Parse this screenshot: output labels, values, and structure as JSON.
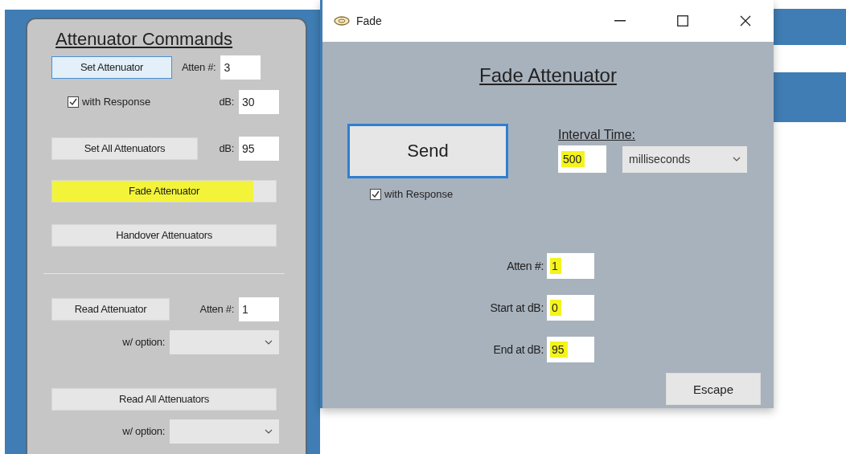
{
  "panel": {
    "title": "Attenuator Commands",
    "set_attenuator": {
      "button": "Set Attenuator",
      "focused": true,
      "atten_label": "Atten #:",
      "atten_value": "3",
      "with_response": {
        "label": "with Response",
        "checked": true
      },
      "db_label": "dB:",
      "db_value": "30"
    },
    "set_all": {
      "button": "Set All Attenuators",
      "db_label": "dB:",
      "db_value": "95"
    },
    "fade_button": {
      "label": "Fade Attenuator",
      "highlighted": true
    },
    "handover_button": {
      "label": "Handover Attenuators",
      "highlighted": false
    },
    "read_attenuator": {
      "button": "Read Attenuator",
      "atten_label": "Atten #:",
      "atten_value": "1",
      "option_label": "w/ option:"
    },
    "read_all": {
      "button": "Read All Attenuators",
      "option_label": "w/ option:"
    }
  },
  "dialog": {
    "title": "Fade",
    "heading": "Fade Attenuator",
    "send_button": "Send",
    "with_response": {
      "label": "with Response",
      "checked": true
    },
    "interval_label": "Interval Time:",
    "interval_value": {
      "value": "500",
      "highlighted": true
    },
    "unit": "milliseconds",
    "fields": [
      {
        "label": "Atten #:",
        "value": "1",
        "highlighted": true
      },
      {
        "label": "Start at dB:",
        "value": "0",
        "highlighted": true
      },
      {
        "label": "End at dB:",
        "value": "95",
        "highlighted": true
      }
    ],
    "escape_button": "Escape"
  }
}
